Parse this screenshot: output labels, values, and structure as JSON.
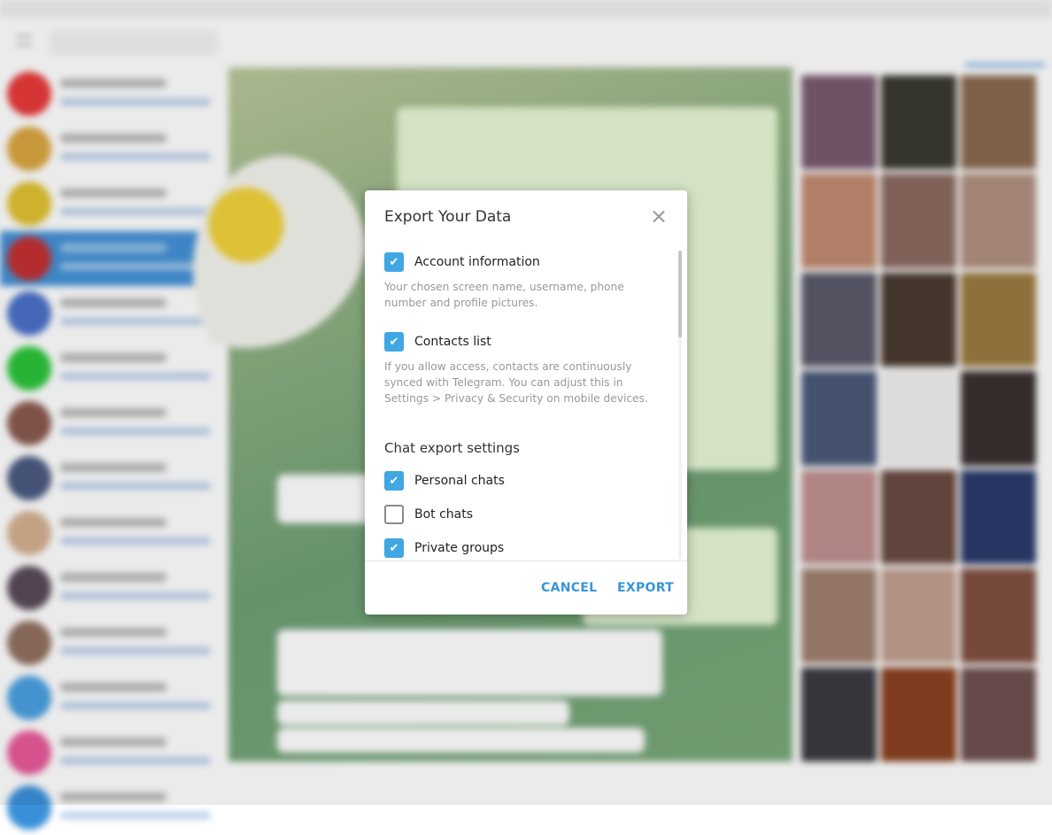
{
  "dialog": {
    "title": "Export Your Data",
    "options": [
      {
        "label": "Account information",
        "checked": true,
        "description": "Your chosen screen name, username, phone number and profile pictures."
      },
      {
        "label": "Contacts list",
        "checked": true,
        "description": "If you allow access, contacts are continuously synced with Telegram. You can adjust this in Settings > Privacy & Security on mobile devices."
      }
    ],
    "section_title": "Chat export settings",
    "chat_options": [
      {
        "label": "Personal chats",
        "checked": true
      },
      {
        "label": "Bot chats",
        "checked": false
      },
      {
        "label": "Private groups",
        "checked": true
      }
    ],
    "cancel_label": "CANCEL",
    "export_label": "EXPORT"
  },
  "colors": {
    "accent": "#40a7e3",
    "selected_row": "#4391d6",
    "button_text": "#3a95d4"
  },
  "avatar_colors": [
    "#e83a3a",
    "#d9a640",
    "#e0c030",
    "#c43030",
    "#4a70c8",
    "#2bc43a",
    "#8a5a50",
    "#4a5a80",
    "#d4b090",
    "#5a4a5a",
    "#907060",
    "#4aa0e0",
    "#e85a9a",
    "#3a90d8"
  ]
}
